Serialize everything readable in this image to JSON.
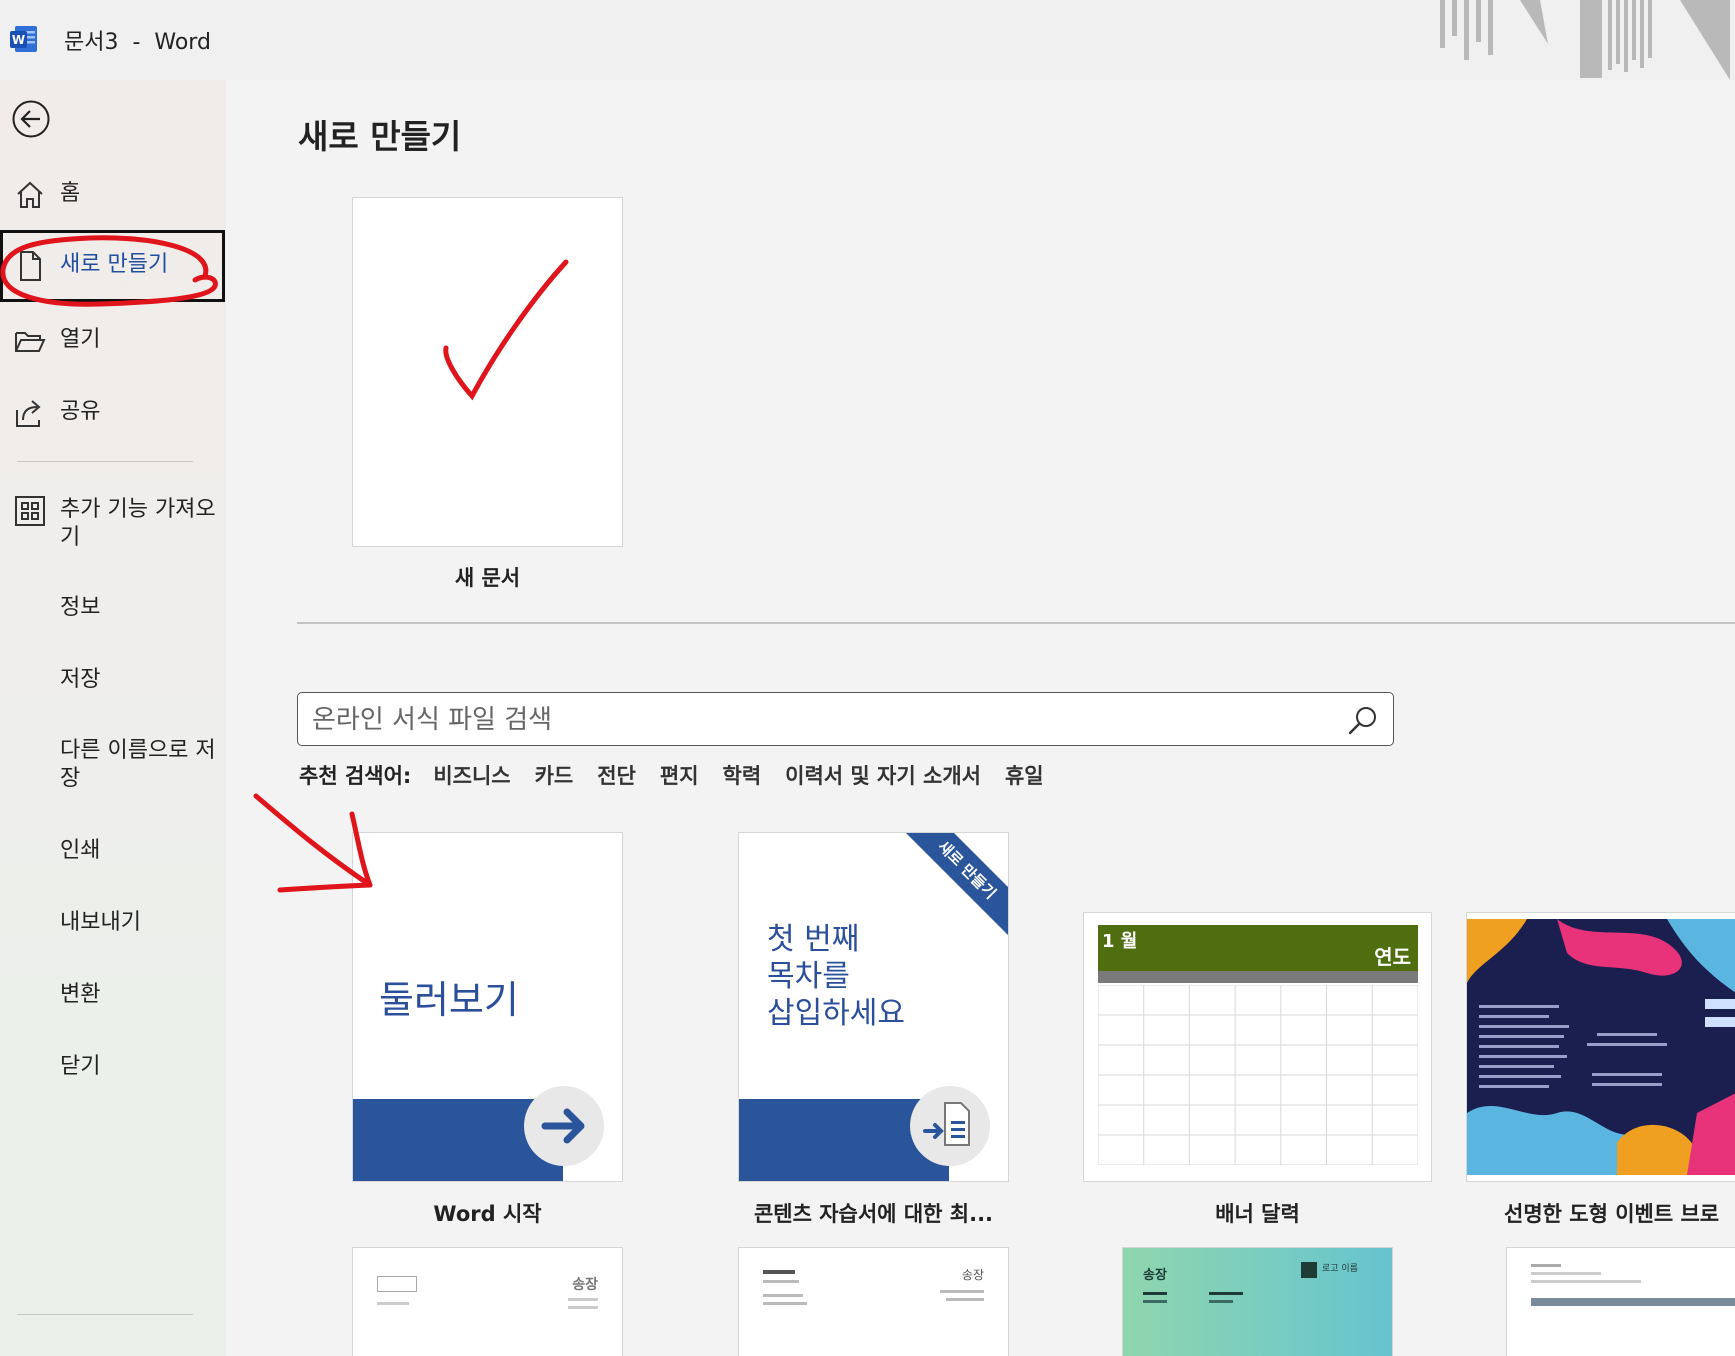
{
  "window": {
    "title": "문서3  -  Word"
  },
  "sidebar": {
    "items": [
      {
        "label": "홈",
        "icon": "home-icon"
      },
      {
        "label": "새로 만들기",
        "icon": "new-document-icon",
        "active": true
      },
      {
        "label": "열기",
        "icon": "folder-open-icon"
      },
      {
        "label": "공유",
        "icon": "share-icon"
      },
      {
        "label": "추가 기능 가져오기",
        "icon": "add-ins-grid-icon"
      },
      {
        "label": "정보"
      },
      {
        "label": "저장"
      },
      {
        "label": "다른 이름으로 저장"
      },
      {
        "label": "인쇄"
      },
      {
        "label": "내보내기"
      },
      {
        "label": "변환"
      },
      {
        "label": "닫기"
      }
    ]
  },
  "main": {
    "title": "새로 만들기",
    "blank_doc_label": "새 문서",
    "search": {
      "placeholder": "온라인 서식 파일 검색"
    },
    "suggested": {
      "label": "추천 검색어:",
      "terms": [
        "비즈니스",
        "카드",
        "전단",
        "편지",
        "학력",
        "이력서 및 자기 소개서",
        "휴일"
      ]
    },
    "templates": [
      {
        "caption": "Word 시작",
        "text": "둘러보기"
      },
      {
        "caption": "콘텐츠 자습서에 대한 최...",
        "text": "첫 번째\n목차를\n삽입하세요",
        "ribbon": "새로 만들기"
      },
      {
        "caption": "배너 달력",
        "month": "1 월",
        "year": "연도"
      },
      {
        "caption": "선명한 도형 이벤트 브로"
      }
    ],
    "lower_templates": [
      {
        "header_text": "송장"
      },
      {
        "header_text": "송장"
      },
      {
        "header_text": "송장",
        "sub": "로고 이름"
      },
      {
        "header_text": ""
      }
    ]
  },
  "colors": {
    "accent_blue": "#2b559b",
    "calendar_green": "#4e6e0f",
    "annotation_red": "#e0141b"
  }
}
